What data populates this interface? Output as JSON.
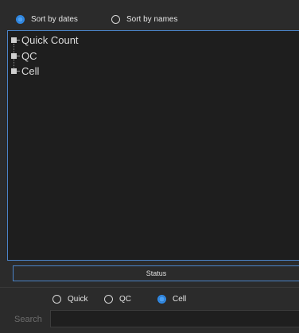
{
  "sort_options": {
    "dates_label": "Sort by dates",
    "names_label": "Sort by names",
    "selected": "dates"
  },
  "tree": {
    "items": [
      {
        "label": "Quick Count"
      },
      {
        "label": "QC"
      },
      {
        "label": "Cell"
      }
    ]
  },
  "status": {
    "label": "Status"
  },
  "filter_options": {
    "quick_label": "Quick",
    "qc_label": "QC",
    "cell_label": "Cell",
    "selected": "cell"
  },
  "search": {
    "label": "Search",
    "value": "",
    "placeholder": ""
  },
  "colors": {
    "background": "#2b2b2b",
    "panel": "#1e1e1e",
    "accent": "#2f89e6",
    "panel_border": "#4b83c7"
  }
}
